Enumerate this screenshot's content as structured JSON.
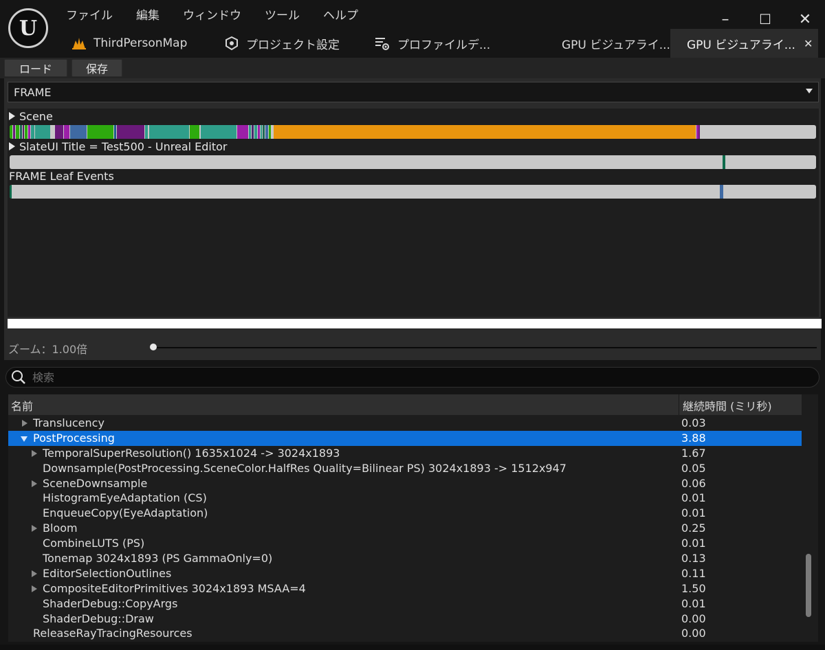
{
  "app": {
    "logo_letter": "U",
    "menu": [
      "ファイル",
      "編集",
      "ウィンドウ",
      "ツール",
      "ヘルプ"
    ]
  },
  "window_controls": {
    "minimize": "–",
    "maximize": "☐",
    "close": "✕"
  },
  "tabs": [
    {
      "label": "ThirdPersonMap",
      "icon": "level-icon",
      "active": false
    },
    {
      "label": "プロジェクト設定",
      "icon": "settings-cube-icon",
      "active": false
    },
    {
      "label": "プロファイルデ...",
      "icon": "profile-data-icon",
      "active": false
    },
    {
      "label": "GPU ビジュアライ...",
      "icon": "",
      "active": false
    },
    {
      "label": "GPU ビジュアライ...",
      "icon": "",
      "active": true,
      "close": "✕"
    }
  ],
  "toolbar": {
    "load_label": "ロード",
    "save_label": "保存"
  },
  "visualizer": {
    "frame_select": "FRAME",
    "rows": [
      {
        "label": "Scene",
        "expandable": true
      },
      {
        "label": "SlateUI Title = Test500 - Unreal Editor",
        "expandable": true
      },
      {
        "label": "FRAME Leaf Events",
        "expandable": false
      }
    ],
    "zoom_label": "ズーム：1.00倍",
    "zoom_value": 1.0,
    "colors": {
      "bar_bg": "#c8c8c8",
      "orange": "#e9950e",
      "green": "#2eaa0e",
      "teal": "#2f9e8a",
      "purple": "#6a1a7a",
      "magenta": "#9c1fa8",
      "blue_marker": "#3f6aa3",
      "green_marker": "#0d6b4b"
    }
  },
  "search": {
    "placeholder": "検索"
  },
  "tree": {
    "col_name": "名前",
    "col_duration": "継続時間 (ミリ秒)",
    "rows": [
      {
        "name": "Translucency",
        "duration": "0.03",
        "level": 1,
        "arrow": "right"
      },
      {
        "name": "PostProcessing",
        "duration": "3.88",
        "level": 1,
        "arrow": "down",
        "selected": true
      },
      {
        "name": "TemporalSuperResolution() 1635x1024 -> 3024x1893",
        "duration": "1.67",
        "level": 2,
        "arrow": "right"
      },
      {
        "name": "Downsample(PostProcessing.SceneColor.HalfRes Quality=Bilinear PS) 3024x1893 -> 1512x947",
        "duration": "0.05",
        "level": 2,
        "arrow": ""
      },
      {
        "name": "SceneDownsample",
        "duration": "0.06",
        "level": 2,
        "arrow": "right"
      },
      {
        "name": "HistogramEyeAdaptation (CS)",
        "duration": "0.01",
        "level": 2,
        "arrow": ""
      },
      {
        "name": "EnqueueCopy(EyeAdaptation)",
        "duration": "0.01",
        "level": 2,
        "arrow": ""
      },
      {
        "name": "Bloom",
        "duration": "0.25",
        "level": 2,
        "arrow": "right"
      },
      {
        "name": "CombineLUTS (PS)",
        "duration": "0.01",
        "level": 2,
        "arrow": ""
      },
      {
        "name": "Tonemap 3024x1893 (PS GammaOnly=0)",
        "duration": "0.13",
        "level": 2,
        "arrow": ""
      },
      {
        "name": "EditorSelectionOutlines",
        "duration": "0.11",
        "level": 2,
        "arrow": "right"
      },
      {
        "name": "CompositeEditorPrimitives 3024x1893 MSAA=4",
        "duration": "1.50",
        "level": 2,
        "arrow": "right"
      },
      {
        "name": "ShaderDebug::CopyArgs",
        "duration": "0.01",
        "level": 2,
        "arrow": ""
      },
      {
        "name": "ShaderDebug::Draw",
        "duration": "0.00",
        "level": 2,
        "arrow": ""
      },
      {
        "name": "ReleaseRayTracingResources",
        "duration": "0.00",
        "level": 1,
        "arrow": ""
      }
    ]
  }
}
